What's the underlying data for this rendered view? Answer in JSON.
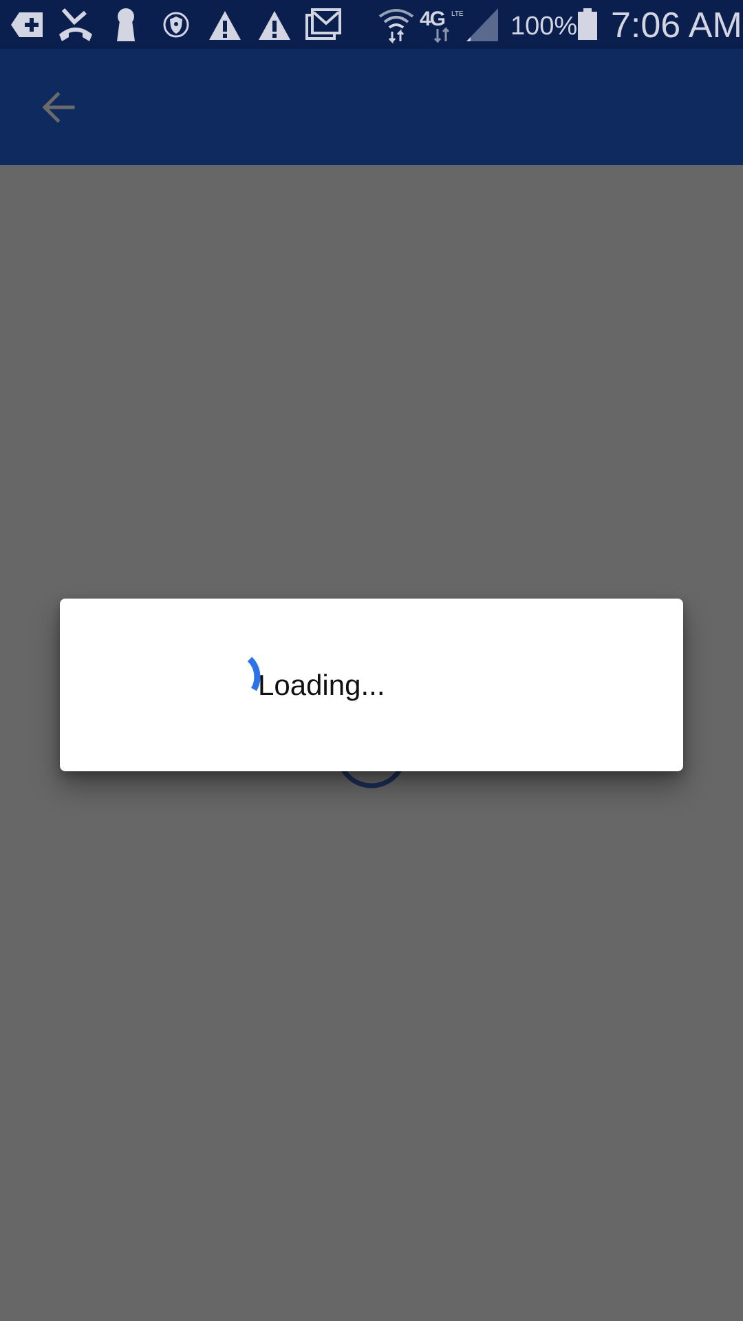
{
  "status_bar": {
    "icons": [
      "add-notification-icon",
      "missed-call-icon",
      "keyhole-icon",
      "shield-icon",
      "warning-icon",
      "warning-icon",
      "gallery-mail-icon",
      "wifi-icon",
      "lte-4g-icon",
      "signal-icon",
      "battery-icon"
    ],
    "network_label": "4G",
    "network_sub": "LTE",
    "battery_percent": "100%",
    "time": "7:06 AM",
    "background": "#0b1f4e",
    "icon_color": "#d3d6e2"
  },
  "app_bar": {
    "background": "#0f2a5e",
    "back_icon": "back-arrow-icon"
  },
  "dialog": {
    "message": "Loading...",
    "spinner_color": "#2a73e8",
    "spinner_icon": "progress-spinner-icon"
  },
  "scrim_color": "#676767"
}
